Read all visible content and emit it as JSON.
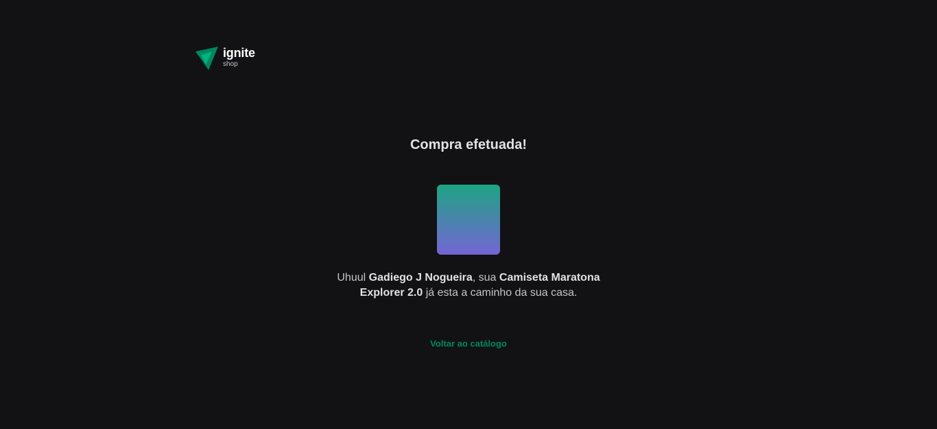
{
  "header": {
    "logo_icon": "ignite-triangle-logo-icon",
    "logo_title": "ignite",
    "logo_subtitle": "shop"
  },
  "main": {
    "title": "Compra efetuada!",
    "message": {
      "greeting": "Uhuul ",
      "customer_name": "Gadiego J Nogueira",
      "middle": ", sua ",
      "product_name": "Camiseta Maratona Explorer 2.0",
      "ending": " já esta a caminho da sua casa."
    },
    "back_link_label": "Voltar ao catálogo"
  },
  "colors": {
    "background": "#121214",
    "accent": "#00875f",
    "gradient_top": "#1ea483",
    "gradient_bottom": "#7465d4"
  }
}
